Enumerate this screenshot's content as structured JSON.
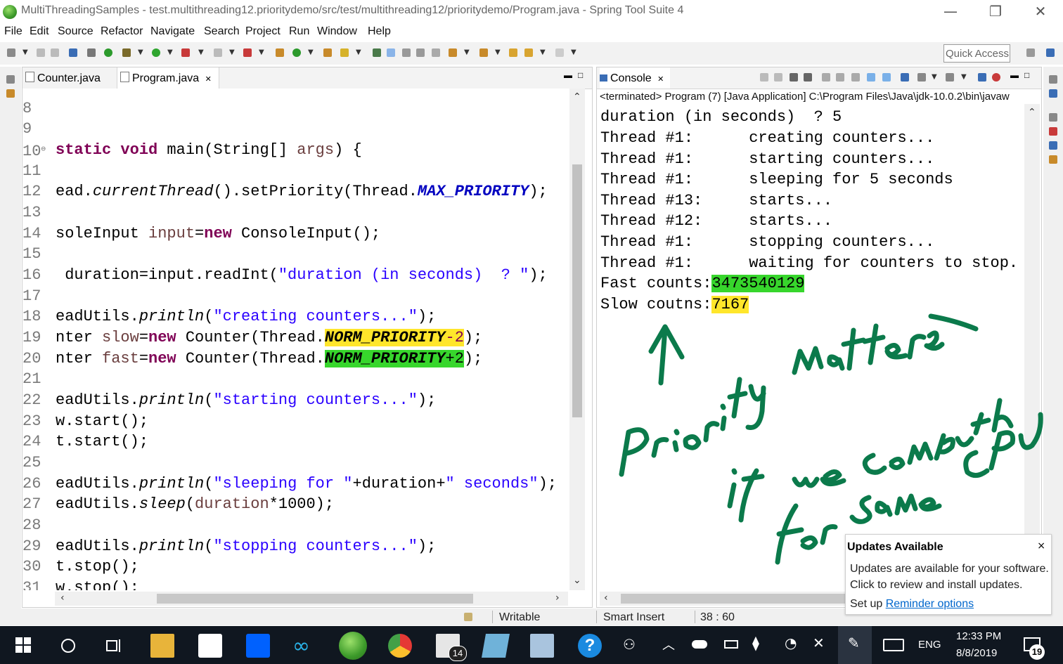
{
  "window": {
    "title": "MultiThreadingSamples - test.multithreading12.prioritydemo/src/test/multithreading12/prioritydemo/Program.java - Spring Tool Suite 4",
    "controls": [
      "—",
      "❐",
      "✕"
    ]
  },
  "menu": [
    "File",
    "Edit",
    "Source",
    "Refactor",
    "Navigate",
    "Search",
    "Project",
    "Run",
    "Window",
    "Help"
  ],
  "toolbar": {
    "quick_access": "Quick Access"
  },
  "editor": {
    "tabs": [
      {
        "label": "Counter.java",
        "active": false
      },
      {
        "label": "Program.java",
        "active": true,
        "close": "✕"
      }
    ],
    "lines": [
      {
        "n": "8"
      },
      {
        "n": "9"
      },
      {
        "n": "10",
        "marker": "⊖"
      },
      {
        "n": "11"
      },
      {
        "n": "12"
      },
      {
        "n": "13"
      },
      {
        "n": "14"
      },
      {
        "n": "15"
      },
      {
        "n": "16"
      },
      {
        "n": "17"
      },
      {
        "n": "18"
      },
      {
        "n": "19"
      },
      {
        "n": "20"
      },
      {
        "n": "21"
      },
      {
        "n": "22"
      },
      {
        "n": "23"
      },
      {
        "n": "24"
      },
      {
        "n": "25"
      },
      {
        "n": "26"
      },
      {
        "n": "27"
      },
      {
        "n": "28"
      },
      {
        "n": "29"
      },
      {
        "n": "30"
      },
      {
        "n": "31"
      }
    ],
    "code": {
      "l10": {
        "kw1": "static",
        "kw2": "void",
        "rest": " main(String[] ",
        "var": "args",
        "end": ") {"
      },
      "l12": {
        "a": "ead.",
        "m": "currentThread",
        "b": "().setPriority(Thread.",
        "f": "MAX_PRIORITY",
        "c": ");"
      },
      "l14": {
        "a": "soleInput ",
        "v": "input",
        "b": "=",
        "k": "new",
        "c": " ConsoleInput();"
      },
      "l16": {
        "a": " duration=input.readInt(",
        "s": "\"duration (in seconds)  ? \"",
        "c": ");"
      },
      "l18": {
        "a": "eadUtils.",
        "m": "println",
        "b": "(",
        "s": "\"creating counters...\"",
        "c": ");"
      },
      "l19": {
        "a": "nter ",
        "v": "slow",
        "b": "=",
        "k": "new",
        "c": " Counter(Thread.",
        "f": "NORM_PRIORITY",
        "d": "-2",
        "e": ");"
      },
      "l20": {
        "a": "nter ",
        "v": "fast",
        "b": "=",
        "k": "new",
        "c": " Counter(Thread.",
        "f": "NORM_PRIORITY",
        "d": "+2",
        "e": ");"
      },
      "l22": {
        "a": "eadUtils.",
        "m": "println",
        "b": "(",
        "s": "\"starting counters...\"",
        "c": ");"
      },
      "l23": {
        "a": "w.start();"
      },
      "l24": {
        "a": "t.start();"
      },
      "l26": {
        "a": "eadUtils.",
        "m": "println",
        "b": "(",
        "s1": "\"sleeping for \"",
        "mid": "+duration+",
        "s2": "\" seconds\"",
        "c": ");"
      },
      "l27": {
        "a": "eadUtils.",
        "m": "sleep",
        "b": "(",
        "v": "duration",
        "c": "*1000);"
      },
      "l29": {
        "a": "eadUtils.",
        "m": "println",
        "b": "(",
        "s": "\"stopping counters...\"",
        "c": ");"
      },
      "l30": {
        "a": "t.stop();"
      },
      "l31": {
        "a": "w.stop();"
      }
    }
  },
  "console": {
    "tab": "Console",
    "close": "✕",
    "description": "<terminated> Program (7) [Java Application] C:\\Program Files\\Java\\jdk-10.0.2\\bin\\javaw",
    "lines": [
      "duration (in seconds)  ? 5",
      "Thread #1:      creating counters...",
      "Thread #1:      starting counters...",
      "Thread #1:      sleeping for 5 seconds",
      "Thread #13:     starts...",
      "Thread #12:     starts...",
      "Thread #1:      stopping counters...",
      "Thread #1:      waiting for counters to stop."
    ],
    "fast_label": "Fast counts:",
    "fast_value": "3473540129",
    "slow_label": "Slow coutns:",
    "slow_value": "7167"
  },
  "annotation": {
    "color": "#0b7a4b"
  },
  "status": {
    "writable": "Writable",
    "insert_mode": "Smart Insert",
    "position": "38 : 60"
  },
  "notification": {
    "title": "Updates Available",
    "close": "×",
    "body_line1": "Updates are available for your software.",
    "body_line2": "Click to review and install updates.",
    "setup_prefix": "Set up ",
    "setup_link": "Reminder options"
  },
  "taskbar": {
    "mail_badge": "14",
    "language": "ENG",
    "time": "12:33 PM",
    "date": "8/8/2019",
    "notification_count": "19"
  },
  "colors": {
    "keyword": "#7f0055",
    "string": "#2a00ff",
    "field": "#0000c0",
    "highlight_yellow": "#ffe62b",
    "highlight_green": "#37d62c",
    "taskbar": "#101720"
  }
}
